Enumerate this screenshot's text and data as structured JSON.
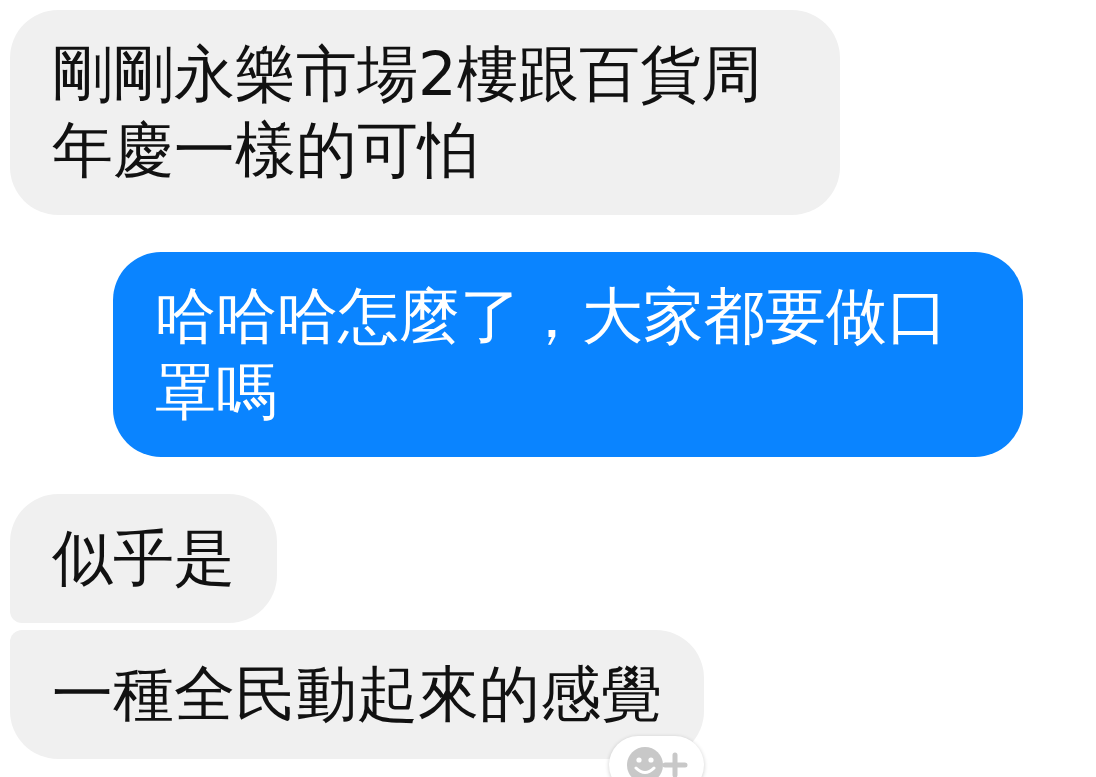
{
  "messages": [
    {
      "kind": "received",
      "text": "剛剛永樂市場2樓跟百貨周年慶一樣的可怕"
    },
    {
      "kind": "sent",
      "text": "哈哈哈怎麼了，大家都要做口罩嗎"
    },
    {
      "kind": "received",
      "text": "似乎是"
    },
    {
      "kind": "received",
      "text": "一種全民動起來的感覺",
      "reaction_button": true
    }
  ]
}
